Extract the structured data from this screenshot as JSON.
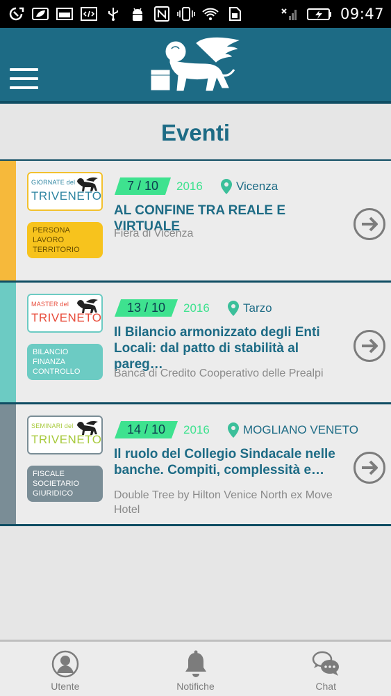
{
  "status_bar": {
    "time": "09:47",
    "icons": [
      "sync-icon",
      "leaf-icon",
      "image-icon",
      "code-icon",
      "usb-icon",
      "android-icon",
      "nfc-icon",
      "vibrate-icon",
      "wifi-icon",
      "sim-icon",
      "signal-icon",
      "battery-charging-icon"
    ]
  },
  "app": {
    "menu_icon": "hamburger-menu-icon",
    "logo": "lion-logo"
  },
  "page": {
    "title": "Eventi"
  },
  "events": [
    {
      "date": "7 / 10",
      "year": "2016",
      "place": "Vicenza",
      "title": "AL CONFINE TRA REALE E VIRTUALE",
      "location": "Fiera di Vicenza",
      "logo_top": "GIORNATE del",
      "logo_main": "TRIVENETO",
      "tag": "PERSONA\nLAVORO\nTERRITORIO",
      "strip_color": "#f6b93b",
      "tag_bg": "#f7c31d",
      "tag_color": "#6a4f00",
      "logo_border": "#f2c12e",
      "logo_top_color": "#2b83a0",
      "logo_main_color": "#2b83a0"
    },
    {
      "date": "13 / 10",
      "year": "2016",
      "place": "Tarzo",
      "title": "Il Bilancio armonizzato degli Enti Locali: dal patto di stabilità al pareg…",
      "location": "Banca di Credito Cooperativo delle Prealpi",
      "logo_top": "MASTER del",
      "logo_main": "TRIVENETO",
      "tag": "BILANCIO\nFINANZA\nCONTROLLO",
      "strip_color": "#6ccbc3",
      "tag_bg": "#6ccbc3",
      "tag_color": "#ffffff",
      "logo_border": "#6ccbc3",
      "logo_top_color": "#e84b3a",
      "logo_main_color": "#e84b3a"
    },
    {
      "date": "14 / 10",
      "year": "2016",
      "place": "MOGLIANO VENETO",
      "title": "Il ruolo del Collegio Sindacale nelle banche. Compiti, complessità e…",
      "location": "Double Tree by Hilton Venice North ex Move Hotel",
      "logo_top": "SEMINARI del",
      "logo_main": "TRIVENETO",
      "tag": "FISCALE\nSOCIETARIO\nGIURIDICO",
      "strip_color": "#7a8d96",
      "tag_bg": "#7a8d96",
      "tag_color": "#ffffff",
      "logo_border": "#7a8d96",
      "logo_top_color": "#a7c93a",
      "logo_main_color": "#a7c93a"
    }
  ],
  "bottom_nav": [
    {
      "label": "Utente",
      "icon": "user-icon"
    },
    {
      "label": "Notifiche",
      "icon": "bell-icon"
    },
    {
      "label": "Chat",
      "icon": "chat-icon"
    }
  ],
  "colors": {
    "primary": "#1d6b85",
    "accent_green": "#3ee28f",
    "gray": "#7c7c7c"
  }
}
